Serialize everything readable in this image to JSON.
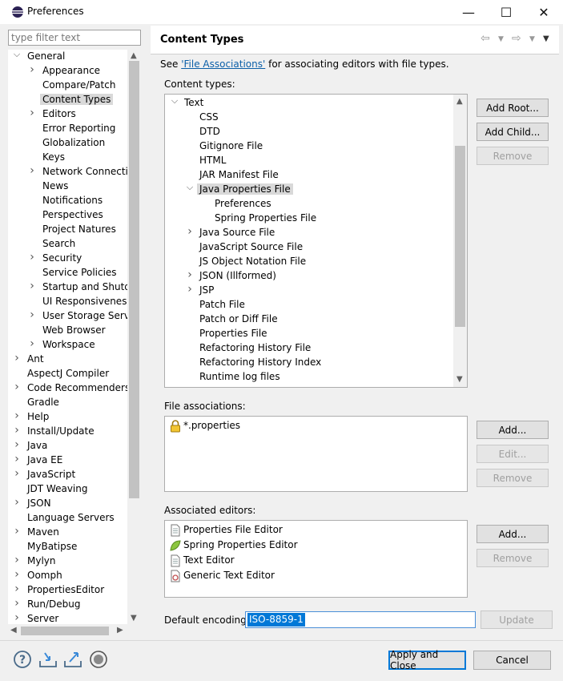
{
  "window": {
    "title": "Preferences",
    "icon": "eclipse-icon",
    "minimize": "—",
    "maximize": "☐",
    "close": "✕"
  },
  "filter": {
    "placeholder": "type filter text",
    "value": ""
  },
  "left_tree": [
    {
      "label": "General",
      "level": 0,
      "expand": "open"
    },
    {
      "label": "Appearance",
      "level": 1,
      "expand": "closed"
    },
    {
      "label": "Compare/Patch",
      "level": 1,
      "expand": "none"
    },
    {
      "label": "Content Types",
      "level": 1,
      "expand": "none",
      "selected": true
    },
    {
      "label": "Editors",
      "level": 1,
      "expand": "closed"
    },
    {
      "label": "Error Reporting",
      "level": 1,
      "expand": "none"
    },
    {
      "label": "Globalization",
      "level": 1,
      "expand": "none"
    },
    {
      "label": "Keys",
      "level": 1,
      "expand": "none"
    },
    {
      "label": "Network Connections",
      "level": 1,
      "expand": "closed"
    },
    {
      "label": "News",
      "level": 1,
      "expand": "none"
    },
    {
      "label": "Notifications",
      "level": 1,
      "expand": "none"
    },
    {
      "label": "Perspectives",
      "level": 1,
      "expand": "none"
    },
    {
      "label": "Project Natures",
      "level": 1,
      "expand": "none"
    },
    {
      "label": "Search",
      "level": 1,
      "expand": "none"
    },
    {
      "label": "Security",
      "level": 1,
      "expand": "closed"
    },
    {
      "label": "Service Policies",
      "level": 1,
      "expand": "none"
    },
    {
      "label": "Startup and Shutdown",
      "level": 1,
      "expand": "closed"
    },
    {
      "label": "UI Responsiveness Monitoring",
      "level": 1,
      "expand": "none"
    },
    {
      "label": "User Storage Service",
      "level": 1,
      "expand": "closed"
    },
    {
      "label": "Web Browser",
      "level": 1,
      "expand": "none"
    },
    {
      "label": "Workspace",
      "level": 1,
      "expand": "closed"
    },
    {
      "label": "Ant",
      "level": 0,
      "expand": "closed"
    },
    {
      "label": "AspectJ Compiler",
      "level": 0,
      "expand": "none"
    },
    {
      "label": "Code Recommenders",
      "level": 0,
      "expand": "closed"
    },
    {
      "label": "Gradle",
      "level": 0,
      "expand": "none"
    },
    {
      "label": "Help",
      "level": 0,
      "expand": "closed"
    },
    {
      "label": "Install/Update",
      "level": 0,
      "expand": "closed"
    },
    {
      "label": "Java",
      "level": 0,
      "expand": "closed"
    },
    {
      "label": "Java EE",
      "level": 0,
      "expand": "closed"
    },
    {
      "label": "JavaScript",
      "level": 0,
      "expand": "closed"
    },
    {
      "label": "JDT Weaving",
      "level": 0,
      "expand": "none"
    },
    {
      "label": "JSON",
      "level": 0,
      "expand": "closed"
    },
    {
      "label": "Language Servers",
      "level": 0,
      "expand": "none"
    },
    {
      "label": "Maven",
      "level": 0,
      "expand": "closed"
    },
    {
      "label": "MyBatipse",
      "level": 0,
      "expand": "none"
    },
    {
      "label": "Mylyn",
      "level": 0,
      "expand": "closed"
    },
    {
      "label": "Oomph",
      "level": 0,
      "expand": "closed"
    },
    {
      "label": "PropertiesEditor",
      "level": 0,
      "expand": "closed"
    },
    {
      "label": "Run/Debug",
      "level": 0,
      "expand": "closed"
    },
    {
      "label": "Server",
      "level": 0,
      "expand": "closed"
    }
  ],
  "page": {
    "title": "Content Types",
    "see_prefix": "See ",
    "see_link": "'File Associations'",
    "see_suffix": " for associating editors with file types.",
    "content_types_label": "Content types:",
    "file_assoc_label": "File associations:",
    "assoc_editors_label": "Associated editors:",
    "encoding_label": "Default encoding:",
    "encoding_value": "ISO-8859-1"
  },
  "content_types": [
    {
      "label": "Text",
      "level": 0,
      "expand": "open"
    },
    {
      "label": "CSS",
      "level": 1,
      "expand": "none"
    },
    {
      "label": "DTD",
      "level": 1,
      "expand": "none"
    },
    {
      "label": "Gitignore File",
      "level": 1,
      "expand": "none"
    },
    {
      "label": "HTML",
      "level": 1,
      "expand": "none"
    },
    {
      "label": "JAR Manifest File",
      "level": 1,
      "expand": "none"
    },
    {
      "label": "Java Properties File",
      "level": 1,
      "expand": "open",
      "selected": true
    },
    {
      "label": "Preferences",
      "level": 2,
      "expand": "none"
    },
    {
      "label": "Spring Properties File",
      "level": 2,
      "expand": "none"
    },
    {
      "label": "Java Source File",
      "level": 1,
      "expand": "closed"
    },
    {
      "label": "JavaScript Source File",
      "level": 1,
      "expand": "none"
    },
    {
      "label": "JS Object Notation File",
      "level": 1,
      "expand": "none"
    },
    {
      "label": "JSON (Illformed)",
      "level": 1,
      "expand": "closed"
    },
    {
      "label": "JSP",
      "level": 1,
      "expand": "closed"
    },
    {
      "label": "Patch File",
      "level": 1,
      "expand": "none"
    },
    {
      "label": "Patch or Diff File",
      "level": 1,
      "expand": "none"
    },
    {
      "label": "Properties File",
      "level": 1,
      "expand": "none"
    },
    {
      "label": "Refactoring History File",
      "level": 1,
      "expand": "none"
    },
    {
      "label": "Refactoring History Index",
      "level": 1,
      "expand": "none"
    },
    {
      "label": "Runtime log files",
      "level": 1,
      "expand": "none"
    }
  ],
  "file_associations": [
    {
      "label": "*.properties",
      "icon": "lock-icon"
    }
  ],
  "associated_editors": [
    {
      "label": "Properties File Editor",
      "icon": "document-icon"
    },
    {
      "label": "Spring Properties Editor",
      "icon": "spring-leaf-icon"
    },
    {
      "label": "Text Editor",
      "icon": "document-icon"
    },
    {
      "label": "Generic Text Editor",
      "icon": "generic-editor-icon"
    }
  ],
  "buttons": {
    "add_root": "Add Root...",
    "add_child": "Add Child...",
    "remove": "Remove",
    "add": "Add...",
    "edit": "Edit...",
    "update": "Update",
    "apply_close": "Apply and Close",
    "cancel": "Cancel"
  },
  "bottom_icons": [
    "help-icon",
    "import-icon",
    "export-icon",
    "record-icon"
  ]
}
